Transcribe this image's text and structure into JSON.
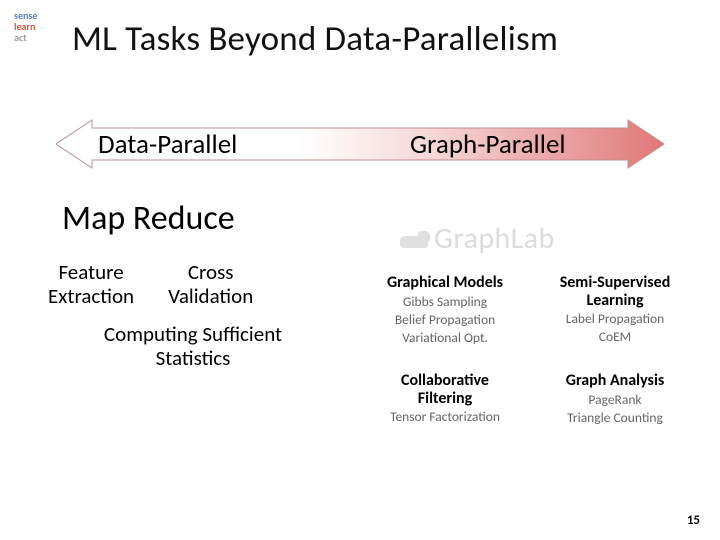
{
  "logo": {
    "line1": "sense",
    "line2": "learn",
    "line3": "act"
  },
  "title": "ML Tasks Beyond Data-Parallelism",
  "arrows": {
    "left": "Data-Parallel",
    "right": "Graph-Parallel"
  },
  "left_header": "Map Reduce",
  "left_items": {
    "feature": {
      "l1": "Feature",
      "l2": "Extraction"
    },
    "cross": {
      "l1": "Cross",
      "l2": "Validation"
    },
    "stats": {
      "l1": "Computing Sufficient",
      "l2": "Statistics"
    }
  },
  "graphlab": "GraphLab",
  "right": {
    "gm": {
      "hd": "Graphical Models",
      "s1": "Gibbs Sampling",
      "s2": "Belief Propagation",
      "s3": "Variational Opt."
    },
    "ssl": {
      "hd1": "Semi-Supervised",
      "hd2": "Learning",
      "s1": "Label Propagation",
      "s2": "CoEM"
    },
    "cf": {
      "hd1": "Collaborative",
      "hd2": "Filtering",
      "s1": "Tensor Factorization"
    },
    "ga": {
      "hd": "Graph Analysis",
      "s1": "PageRank",
      "s2": "Triangle Counting"
    }
  },
  "page": "15"
}
